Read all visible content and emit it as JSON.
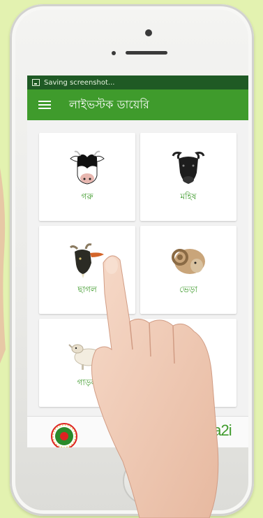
{
  "status_bar": {
    "text": "Saving screenshot..."
  },
  "app_bar": {
    "title": "লাইভস্টক ডায়েরি",
    "menu_icon": "hamburger-icon"
  },
  "animals": [
    {
      "label": "গরু",
      "icon": "cow-icon"
    },
    {
      "label": "মহিষ",
      "icon": "buffalo-icon"
    },
    {
      "label": "ছাগল",
      "icon": "goat-icon"
    },
    {
      "label": "ভেড়া",
      "icon": "ram-icon"
    },
    {
      "label": "গাড়ল",
      "icon": "sheep-icon"
    },
    {
      "label": "",
      "icon": "poultry-icon"
    }
  ],
  "footer": {
    "left_logo": "bangladesh-government-seal",
    "right_logo_text": "a2i"
  },
  "colors": {
    "primary": "#3f9b2c",
    "status_bar": "#1f5a24"
  }
}
